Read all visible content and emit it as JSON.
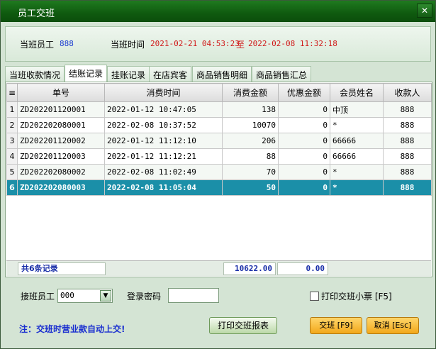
{
  "window": {
    "title": "员工交班",
    "close_glyph": "✕"
  },
  "info": {
    "staff_label": "当班员工",
    "staff_value": "888",
    "time_label": "当班时间",
    "time_from": "2021-02-21 04:53:23",
    "time_sep": "至",
    "time_to": "2022-02-08 11:32:18"
  },
  "tabs": [
    "当班收款情况",
    "结账记录",
    "挂账记录",
    "在店宾客",
    "商品销售明细",
    "商品销售汇总"
  ],
  "table": {
    "headers": [
      "单号",
      "消费时间",
      "消费金额",
      "优惠金额",
      "会员姓名",
      "收款人"
    ],
    "rows": [
      {
        "idx": "1",
        "no": "ZD202201120001",
        "time": "2022-01-12 10:47:05",
        "amount": "138",
        "discount": "0",
        "member": "中顶",
        "cashier": "888"
      },
      {
        "idx": "2",
        "no": "ZD202202080001",
        "time": "2022-02-08 10:37:52",
        "amount": "10070",
        "discount": "0",
        "member": "*",
        "cashier": "888"
      },
      {
        "idx": "3",
        "no": "ZD202201120002",
        "time": "2022-01-12 11:12:10",
        "amount": "206",
        "discount": "0",
        "member": "66666",
        "cashier": "888"
      },
      {
        "idx": "4",
        "no": "ZD202201120003",
        "time": "2022-01-12 11:12:21",
        "amount": "88",
        "discount": "0",
        "member": "66666",
        "cashier": "888"
      },
      {
        "idx": "5",
        "no": "ZD202202080002",
        "time": "2022-02-08 11:02:49",
        "amount": "70",
        "discount": "0",
        "member": "*",
        "cashier": "888"
      },
      {
        "idx": "6",
        "no": "ZD202202080003",
        "time": "2022-02-08 11:05:04",
        "amount": "50",
        "discount": "0",
        "member": "*",
        "cashier": "888"
      }
    ],
    "footer": {
      "count": "共6条记录",
      "amount_total": "10622.00",
      "discount_total": "0.00"
    }
  },
  "bottom": {
    "handover_label": "接班员工",
    "handover_value": "000",
    "password_label": "登录密码",
    "print_ticket_label": "打印交班小票 [F5]",
    "note": "注：交班时营业款自动上交!",
    "print_report_button": "打印交班报表",
    "handover_button": "交班 [F9]",
    "cancel_button": "取消 [Esc]"
  }
}
